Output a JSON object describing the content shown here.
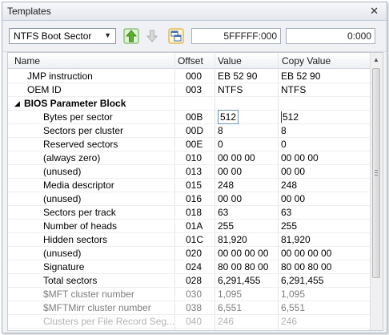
{
  "panel": {
    "title": "Templates"
  },
  "toolbar": {
    "template_selected": "NTFS Boot Sector",
    "position_value": "5FFFFF:000",
    "copy_position_value": "0:000"
  },
  "columns": {
    "name": "Name",
    "offset": "Offset",
    "value": "Value",
    "copy_value": "Copy Value"
  },
  "rows": [
    {
      "name": "JMP instruction",
      "offset": "000",
      "value": "EB 52 90",
      "copy": "EB 52 90"
    },
    {
      "name": "OEM ID",
      "offset": "003",
      "value": "NTFS",
      "copy": "NTFS"
    },
    {
      "name": "BIOS Parameter Block",
      "offset": "",
      "value": "",
      "copy": "",
      "group": true
    },
    {
      "name": "Bytes per sector",
      "offset": "00B",
      "value": "512",
      "copy": "512",
      "boxed": true
    },
    {
      "name": "Sectors per cluster",
      "offset": "00D",
      "value": "8",
      "copy": "8"
    },
    {
      "name": "Reserved sectors",
      "offset": "00E",
      "value": "0",
      "copy": "0"
    },
    {
      "name": "(always zero)",
      "offset": "010",
      "value": "00 00 00",
      "copy": "00 00 00"
    },
    {
      "name": "(unused)",
      "offset": "013",
      "value": "00 00",
      "copy": "00 00"
    },
    {
      "name": "Media descriptor",
      "offset": "015",
      "value": "248",
      "copy": "248"
    },
    {
      "name": "(unused)",
      "offset": "016",
      "value": "00 00",
      "copy": "00 00"
    },
    {
      "name": "Sectors per track",
      "offset": "018",
      "value": "63",
      "copy": "63"
    },
    {
      "name": "Number of heads",
      "offset": "01A",
      "value": "255",
      "copy": "255"
    },
    {
      "name": "Hidden sectors",
      "offset": "01C",
      "value": "81,920",
      "copy": "81,920"
    },
    {
      "name": "(unused)",
      "offset": "020",
      "value": "00 00 00 00",
      "copy": "00 00 00 00"
    },
    {
      "name": "Signature",
      "offset": "024",
      "value": "80 00 80 00",
      "copy": "80 00 80 00"
    },
    {
      "name": "Total sectors",
      "offset": "028",
      "value": "6,291,455",
      "copy": "6,291,455"
    },
    {
      "name": "$MFT cluster number",
      "offset": "030",
      "value": "1,095",
      "copy": "1,095",
      "fade": 1
    },
    {
      "name": "$MFTMirr cluster number",
      "offset": "038",
      "value": "6,551",
      "copy": "6,551",
      "fade": 1
    },
    {
      "name": "Clusters per File Record Seg...",
      "offset": "040",
      "value": "246",
      "copy": "246",
      "fade": 2
    }
  ],
  "colors": {
    "accent_green": "#58b02d",
    "selection_border": "#6f8fbf"
  }
}
